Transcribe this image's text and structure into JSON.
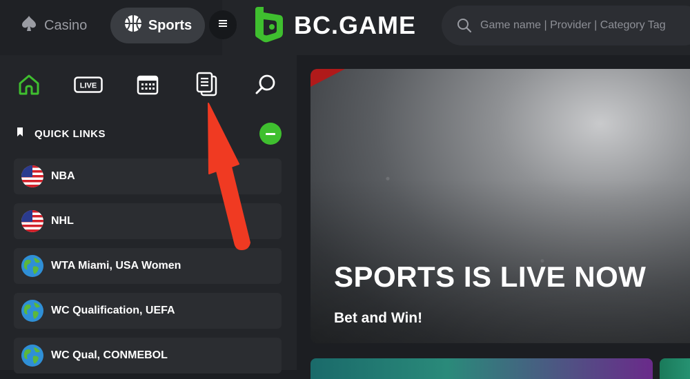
{
  "header": {
    "casino_label": "Casino",
    "sports_label": "Sports",
    "brand": "BC.GAME",
    "search_placeholder": "Game name | Provider | Category Tag"
  },
  "sidebar": {
    "nav": [
      {
        "name": "home-icon"
      },
      {
        "name": "live-icon",
        "label": "LIVE"
      },
      {
        "name": "calendar-icon"
      },
      {
        "name": "betslip-icon"
      },
      {
        "name": "search-icon"
      }
    ],
    "quick_links_title": "QUICK LINKS",
    "links": [
      {
        "label": "NBA",
        "flag": "us-flag-icon"
      },
      {
        "label": "NHL",
        "flag": "us-flag-icon"
      },
      {
        "label": "WTA Miami, USA Women",
        "flag": "globe-icon"
      },
      {
        "label": "WC Qualification, UEFA",
        "flag": "globe-icon"
      },
      {
        "label": "WC Qual, CONMEBOL",
        "flag": "globe-icon"
      }
    ]
  },
  "banner": {
    "title": "SPORTS IS LIVE NOW",
    "subtitle": "Bet and Win!"
  },
  "colors": {
    "accent_green": "#3fbf2f",
    "annotation_red": "#f03a22",
    "background": "#1c1e22",
    "panel": "#232529"
  }
}
